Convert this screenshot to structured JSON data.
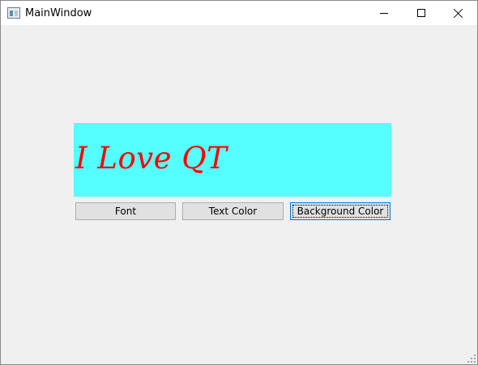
{
  "window": {
    "title": "MainWindow",
    "icon": "window-app-icon"
  },
  "title_controls": {
    "minimize": "minimize-icon",
    "maximize": "maximize-icon",
    "close": "close-icon"
  },
  "display_label": {
    "text": "I Love QT",
    "text_color": "#ff0000",
    "background_color": "#55ffff"
  },
  "buttons": {
    "font": "Font",
    "text_color": "Text Color",
    "background_color": "Background Color"
  }
}
